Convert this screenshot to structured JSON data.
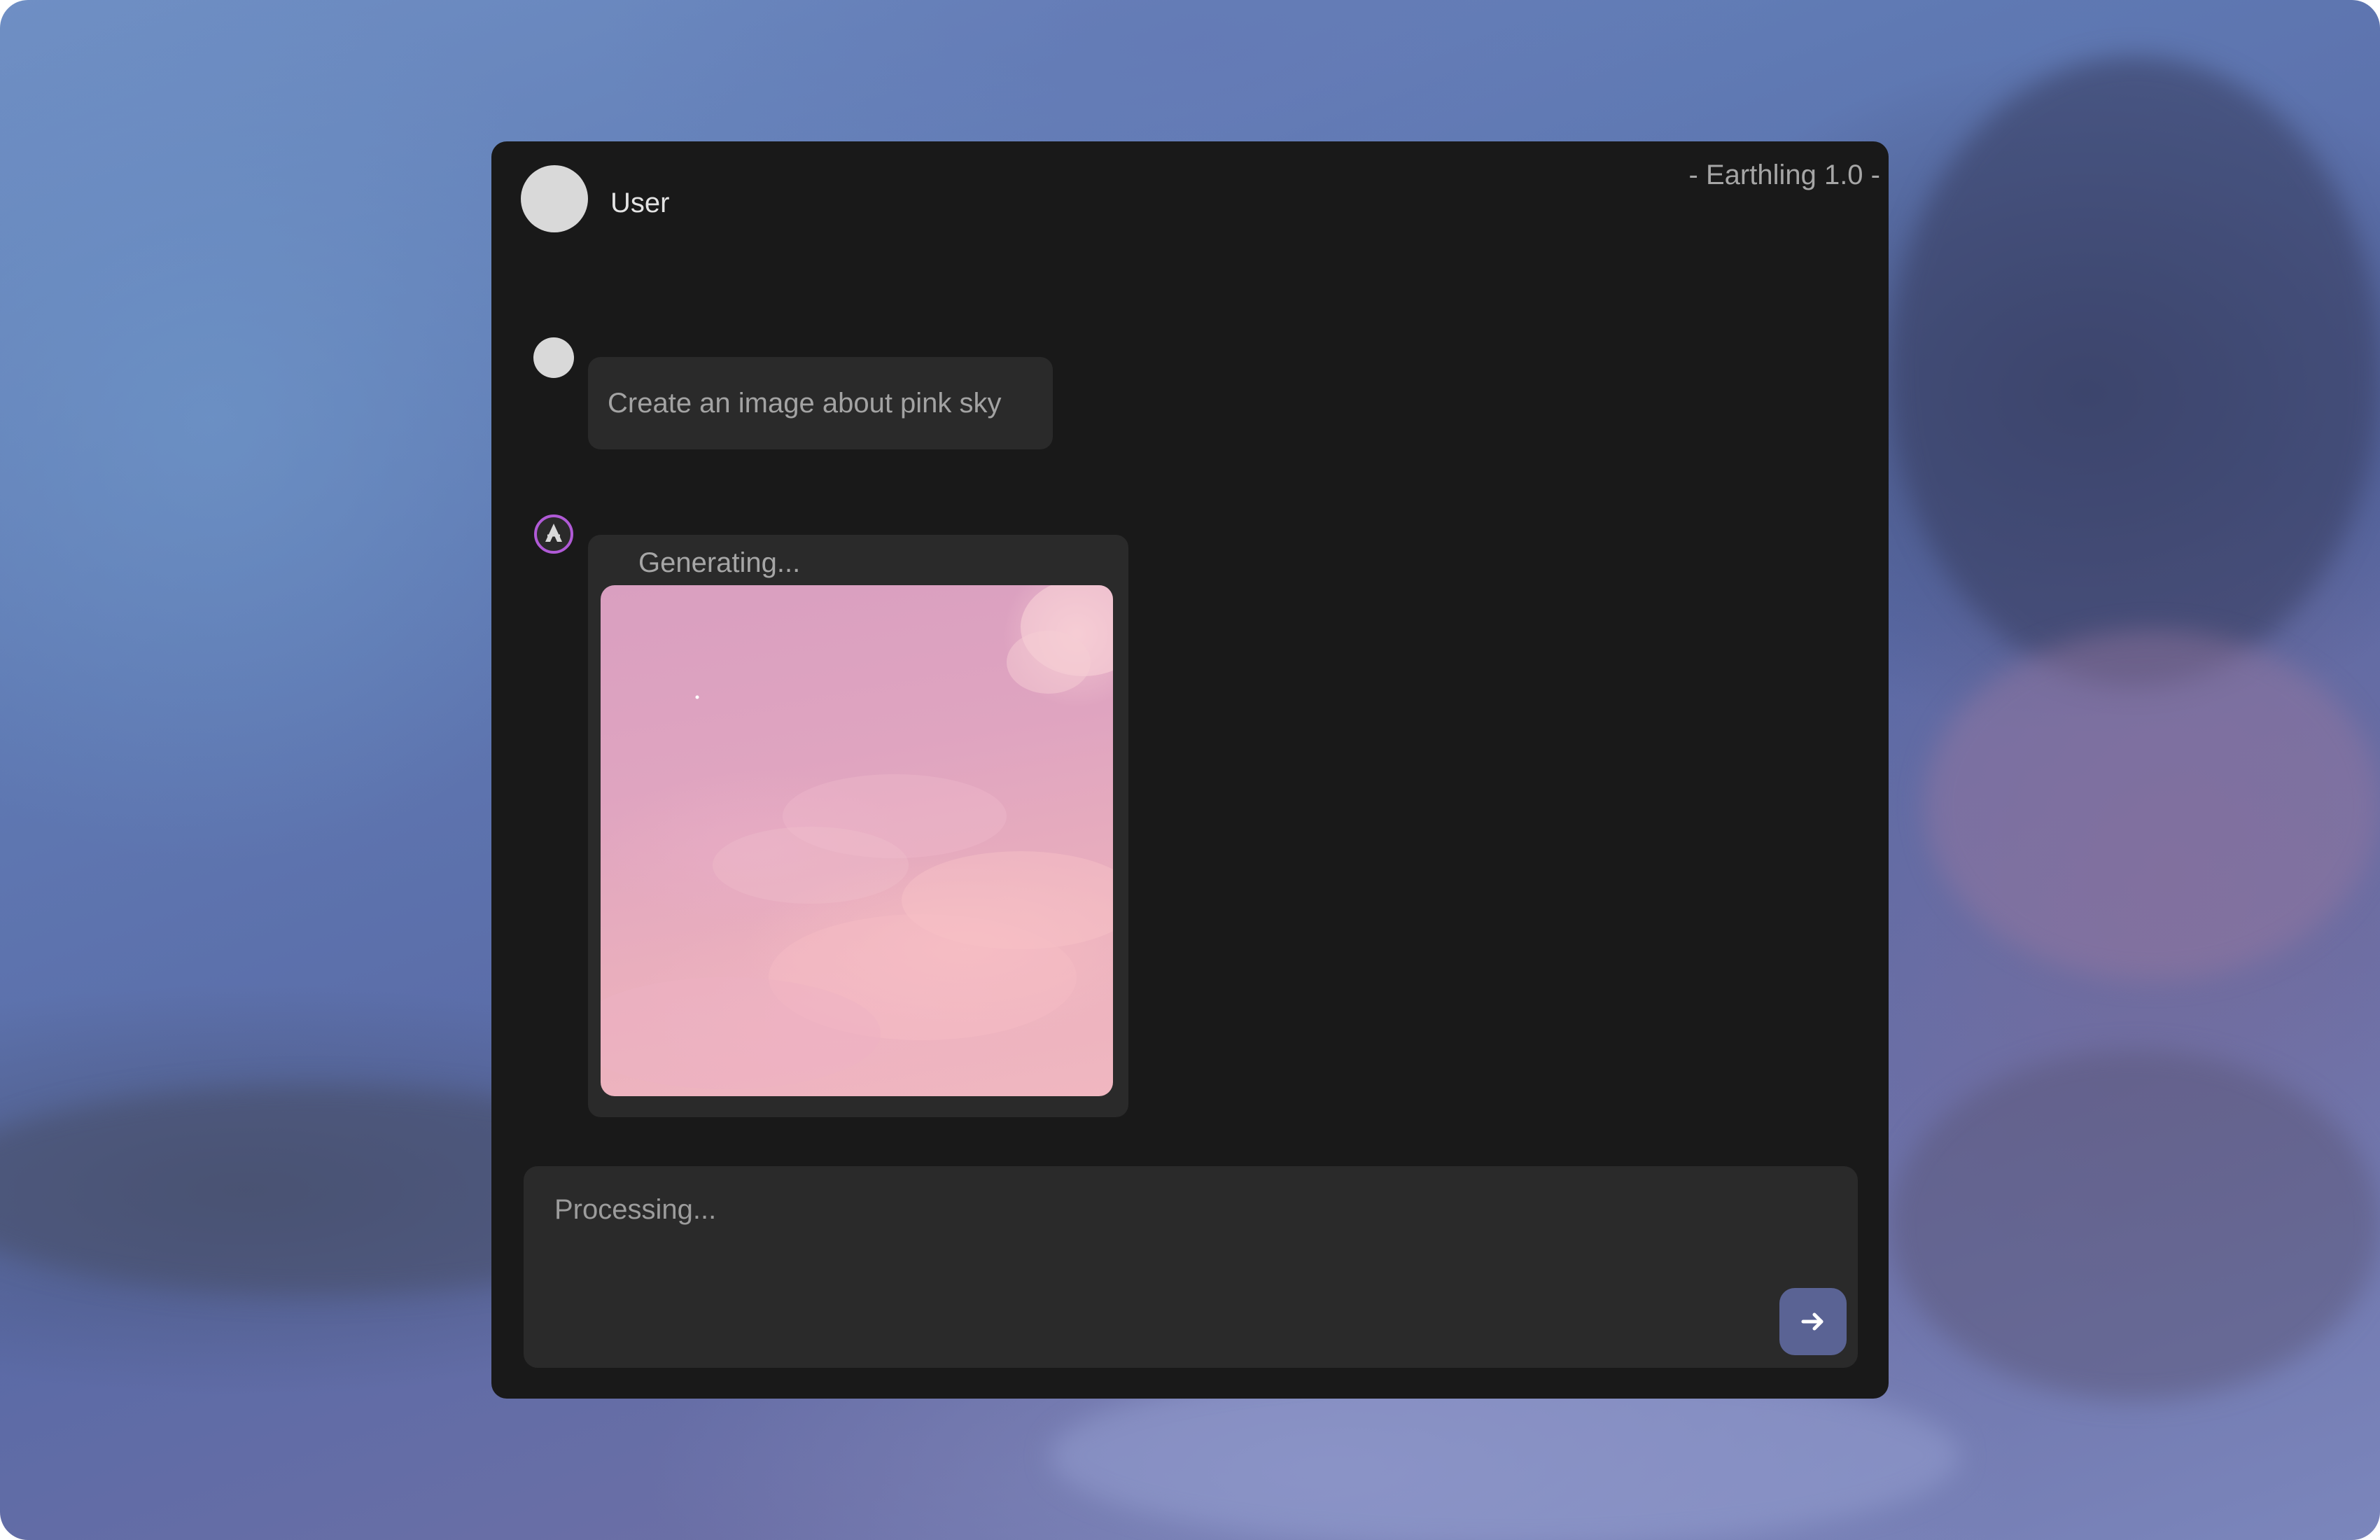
{
  "header": {
    "user_name": "User",
    "app_version": "- Earthling 1.0 -"
  },
  "conversation": {
    "user_message": "Create an image about pink sky",
    "bot_status": "Generating...",
    "bot_image_icon": "pink-sky-image"
  },
  "composer": {
    "placeholder": "Processing...",
    "send_icon": "arrow-right-icon"
  },
  "colors": {
    "window_bg": "#191919",
    "bubble_bg": "#2a2a2a",
    "send_button": "#5a6394",
    "bot_avatar_ring": "#b05ad6"
  }
}
